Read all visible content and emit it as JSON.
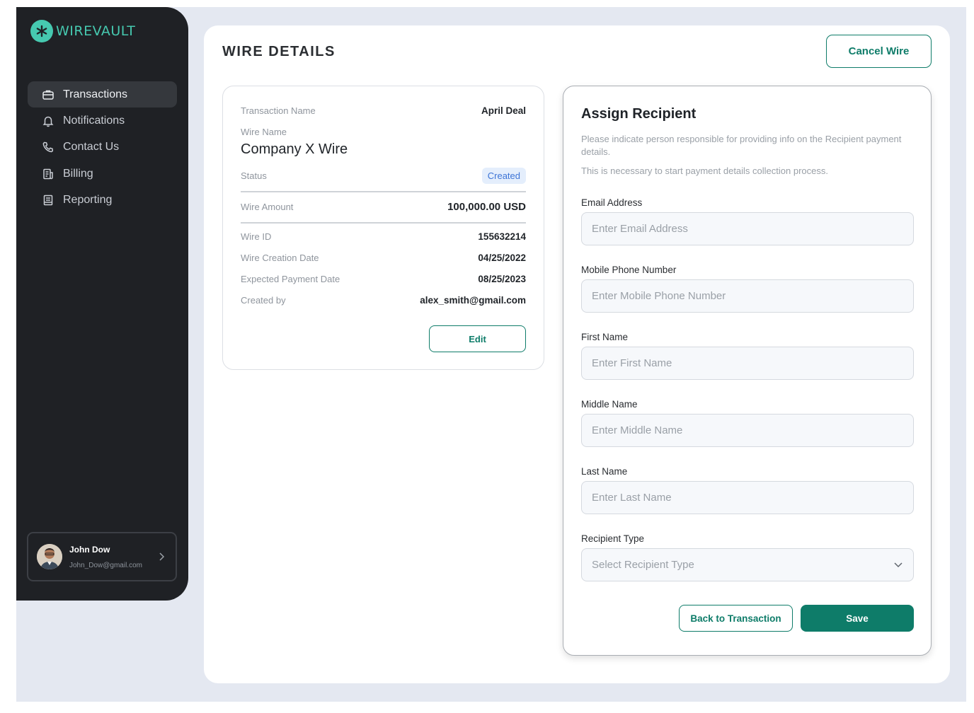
{
  "app": {
    "brand": "WIREVAULT",
    "accent_color": "#0e7c69",
    "brand_color": "#46c9b0",
    "sidebar_color": "#1f2125"
  },
  "sidebar": {
    "items": [
      {
        "label": "Transactions",
        "icon": "briefcase-icon",
        "active": true
      },
      {
        "label": "Notifications",
        "icon": "bell-icon",
        "active": false
      },
      {
        "label": "Contact Us",
        "icon": "phone-icon",
        "active": false
      },
      {
        "label": "Billing",
        "icon": "invoice-icon",
        "active": false
      },
      {
        "label": "Reporting",
        "icon": "report-icon",
        "active": false
      }
    ],
    "user": {
      "name": "John Dow",
      "email": "John_Dow@gmail.com"
    }
  },
  "header": {
    "title": "WIRE DETAILS",
    "cancel_label": "Cancel Wire"
  },
  "details": {
    "transaction_name_label": "Transaction Name",
    "transaction_name": "April Deal",
    "wire_name_label": "Wire Name",
    "wire_name": "Company X Wire",
    "status_label": "Status",
    "status": "Created",
    "status_color": "#3d74d6",
    "wire_amount_label": "Wire Amount",
    "wire_amount": "100,000.00 USD",
    "wire_id_label": "Wire ID",
    "wire_id": "155632214",
    "creation_date_label": "Wire Creation Date",
    "creation_date": "04/25/2022",
    "expected_date_label": "Expected Payment Date",
    "expected_date": "08/25/2023",
    "created_by_label": "Created by",
    "created_by": "alex_smith@gmail.com",
    "edit_label": "Edit"
  },
  "assign": {
    "title": "Assign Recipient",
    "desc1": "Please indicate person responsible for providing info on the Recipient payment details.",
    "desc2": "This is necessary to start payment details collection process.",
    "fields": [
      {
        "label": "Email Address",
        "placeholder": "Enter Email Address",
        "value": ""
      },
      {
        "label": "Mobile Phone Number",
        "placeholder": "Enter Mobile Phone Number",
        "value": ""
      },
      {
        "label": "First Name",
        "placeholder": "Enter First Name",
        "value": ""
      },
      {
        "label": "Middle Name",
        "placeholder": "Enter Middle Name",
        "value": ""
      },
      {
        "label": "Last Name",
        "placeholder": "Enter Last Name",
        "value": ""
      }
    ],
    "recipient_type": {
      "label": "Recipient Type",
      "selected": "Select Recipient Type"
    },
    "back_label": "Back to Transaction",
    "save_label": "Save"
  }
}
